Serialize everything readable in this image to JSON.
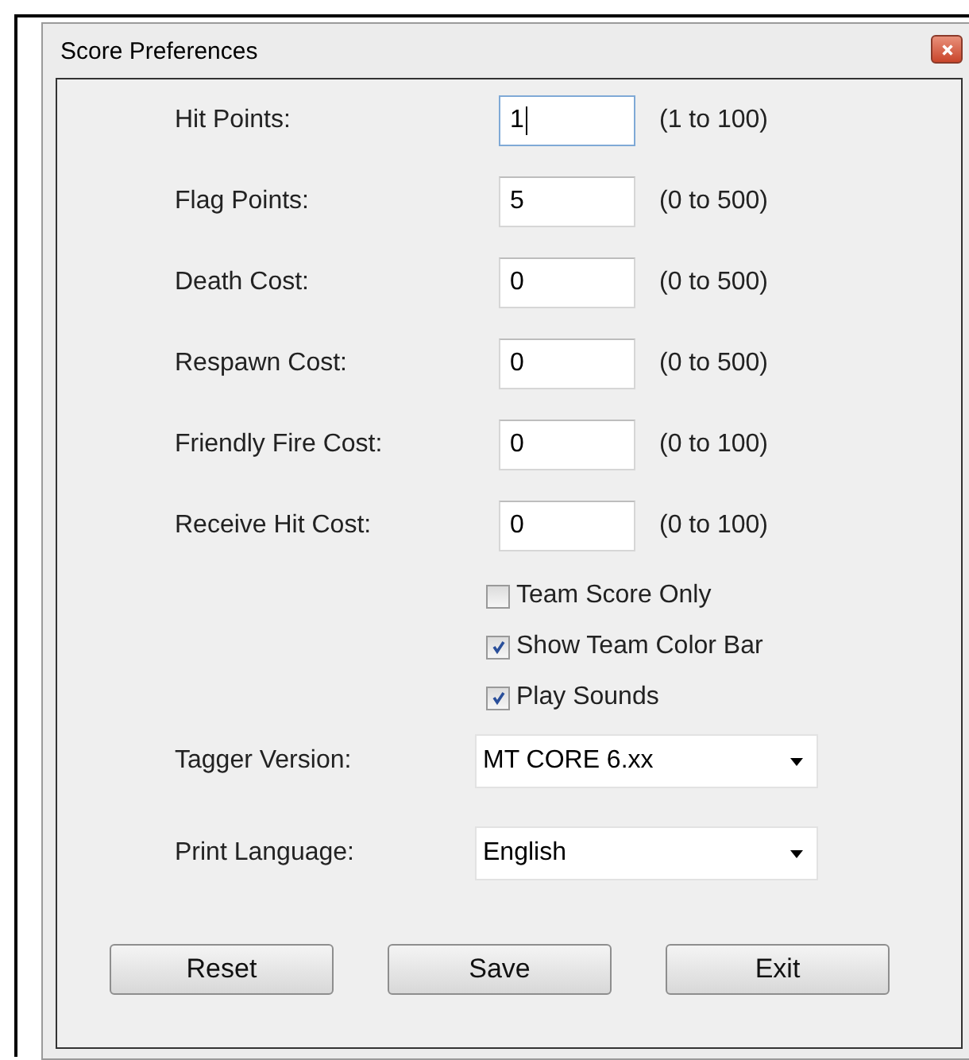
{
  "window": {
    "title": "Score Preferences"
  },
  "fields": [
    {
      "label": "Hit Points:",
      "value": "1",
      "range": "(1 to 100)",
      "focused": true
    },
    {
      "label": "Flag Points:",
      "value": "5",
      "range": "(0 to 500)",
      "focused": false
    },
    {
      "label": "Death Cost:",
      "value": "0",
      "range": "(0 to 500)",
      "focused": false
    },
    {
      "label": "Respawn Cost:",
      "value": "0",
      "range": "(0 to 500)",
      "focused": false
    },
    {
      "label": "Friendly Fire Cost:",
      "value": "0",
      "range": "(0 to 100)",
      "focused": false
    },
    {
      "label": "Receive Hit Cost:",
      "value": "0",
      "range": "(0 to 100)",
      "focused": false
    }
  ],
  "checkboxes": [
    {
      "label": "Team Score Only",
      "checked": false
    },
    {
      "label": "Show Team Color Bar",
      "checked": true
    },
    {
      "label": "Play Sounds",
      "checked": true
    }
  ],
  "dropdowns": [
    {
      "label": "Tagger Version:",
      "value": "MT CORE 6.xx"
    },
    {
      "label": "Print Language:",
      "value": "English"
    }
  ],
  "buttons": [
    "Reset",
    "Save",
    "Exit"
  ]
}
